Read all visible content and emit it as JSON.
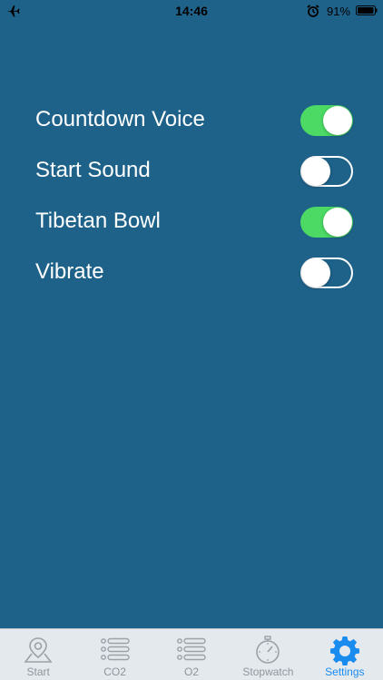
{
  "status_bar": {
    "time": "14:46",
    "battery_percent": "91%",
    "icons": [
      "airplane-icon",
      "alarm-icon",
      "battery-icon"
    ]
  },
  "settings": [
    {
      "label": "Countdown Voice",
      "enabled": true
    },
    {
      "label": "Start Sound",
      "enabled": false
    },
    {
      "label": "Tibetan Bowl",
      "enabled": true
    },
    {
      "label": "Vibrate",
      "enabled": false
    }
  ],
  "tabs": [
    {
      "label": "Start",
      "icon": "map-pin-icon",
      "active": false
    },
    {
      "label": "CO2",
      "icon": "list-icon",
      "active": false
    },
    {
      "label": "O2",
      "icon": "list-icon",
      "active": false
    },
    {
      "label": "Stopwatch",
      "icon": "stopwatch-icon",
      "active": false
    },
    {
      "label": "Settings",
      "icon": "gear-icon",
      "active": true
    }
  ],
  "colors": {
    "background": "#1e6289",
    "toggle_on": "#4cd964",
    "tab_active": "#1a8cf0",
    "tab_inactive": "#8e959b",
    "tab_bar_bg": "#e4e9ee"
  }
}
